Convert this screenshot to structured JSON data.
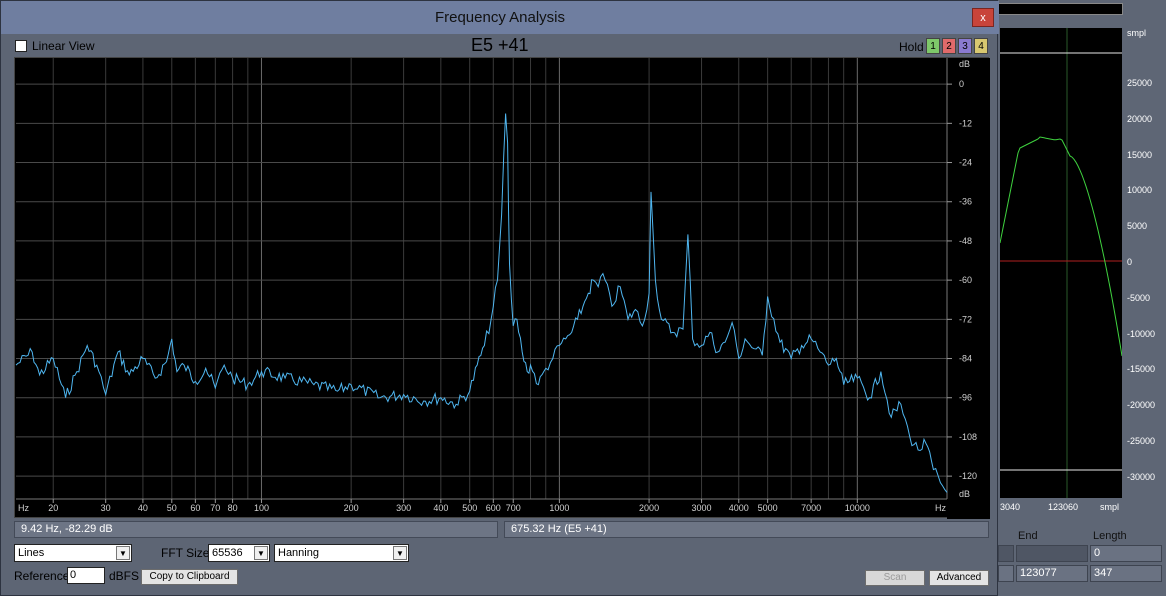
{
  "window": {
    "title": "Frequency Analysis",
    "close_label": "x"
  },
  "toolbar": {
    "linear_view_label": "Linear View",
    "linear_view_checked": false,
    "note_display": "E5 +41",
    "hold_label": "Hold",
    "hold_buttons": [
      {
        "label": "1",
        "color": "#7ec86a"
      },
      {
        "label": "2",
        "color": "#e06a6a"
      },
      {
        "label": "3",
        "color": "#8a7ad0"
      },
      {
        "label": "4",
        "color": "#d8c870"
      }
    ]
  },
  "chart_data": {
    "type": "line",
    "x_scale": "log",
    "xlim": [
      15,
      20000
    ],
    "ylim": [
      -127,
      8
    ],
    "y_unit_label": "dB",
    "x_unit_label": "Hz",
    "y_ticks": [
      "0",
      "-12",
      "-24",
      "-36",
      "-48",
      "-60",
      "-72",
      "-84",
      "-96",
      "-108",
      "-120"
    ],
    "x_ticks": [
      {
        "v": 20,
        "label": "20"
      },
      {
        "v": 30,
        "label": "30"
      },
      {
        "v": 40,
        "label": "40"
      },
      {
        "v": 50,
        "label": "50"
      },
      {
        "v": 60,
        "label": "60"
      },
      {
        "v": 70,
        "label": "70"
      },
      {
        "v": 80,
        "label": "80"
      },
      {
        "v": 100,
        "label": "100"
      },
      {
        "v": 200,
        "label": "200"
      },
      {
        "v": 300,
        "label": "300"
      },
      {
        "v": 400,
        "label": "400"
      },
      {
        "v": 500,
        "label": "500"
      },
      {
        "v": 600,
        "label": "600"
      },
      {
        "v": 700,
        "label": "700"
      },
      {
        "v": 1000,
        "label": "1000"
      },
      {
        "v": 2000,
        "label": "2000"
      },
      {
        "v": 3000,
        "label": "3000"
      },
      {
        "v": 4000,
        "label": "4000"
      },
      {
        "v": 5000,
        "label": "5000"
      },
      {
        "v": 7000,
        "label": "7000"
      },
      {
        "v": 10000,
        "label": "10000"
      }
    ],
    "series_color": "#4fb6f0",
    "series": [
      {
        "x": [
          15,
          17,
          18,
          20,
          22,
          24,
          26,
          28,
          30,
          33,
          36,
          40,
          44,
          48,
          50,
          52,
          55,
          60,
          65,
          70,
          75,
          80,
          90,
          100,
          120,
          150,
          180,
          200,
          250,
          300,
          350,
          400,
          450,
          500,
          530,
          560,
          590,
          620,
          640,
          650,
          660,
          670,
          675,
          680,
          690,
          700,
          720,
          750,
          780,
          800,
          850,
          900,
          950,
          1000,
          1050,
          1100,
          1150,
          1200,
          1250,
          1300,
          1350,
          1400,
          1500,
          1600,
          1700,
          1800,
          1900,
          2000,
          2030,
          2100,
          2200,
          2400,
          2600,
          2700,
          2800,
          3000,
          3200,
          3400,
          3600,
          3800,
          4000,
          4200,
          4500,
          4800,
          5000,
          5500,
          6000,
          6500,
          7000,
          7500,
          8000,
          8500,
          9000,
          10000,
          11000,
          12000,
          13000,
          14000,
          15000,
          16000,
          17000,
          18000,
          19000,
          20000
        ],
        "y": [
          -86,
          -82,
          -89,
          -84,
          -96,
          -88,
          -80,
          -86,
          -95,
          -82,
          -89,
          -84,
          -90,
          -85,
          -78,
          -88,
          -86,
          -91,
          -87,
          -93,
          -86,
          -90,
          -92,
          -88,
          -90,
          -92,
          -94,
          -92,
          -96,
          -95,
          -97,
          -96,
          -98,
          -94,
          -86,
          -80,
          -72,
          -60,
          -40,
          -22,
          -9,
          -18,
          -38,
          -55,
          -66,
          -74,
          -72,
          -82,
          -88,
          -86,
          -92,
          -87,
          -84,
          -80,
          -78,
          -76,
          -72,
          -68,
          -64,
          -60,
          -62,
          -58,
          -68,
          -62,
          -72,
          -69,
          -74,
          -64,
          -33,
          -60,
          -72,
          -76,
          -75,
          -46,
          -78,
          -80,
          -76,
          -82,
          -79,
          -73,
          -84,
          -78,
          -81,
          -83,
          -65,
          -79,
          -84,
          -80,
          -78,
          -82,
          -86,
          -84,
          -92,
          -90,
          -96,
          -88,
          -102,
          -98,
          -108,
          -112,
          -110,
          -118,
          -122,
          -125
        ]
      }
    ]
  },
  "status": {
    "cursor_readout": "9.42 Hz, -82.29 dB",
    "peak_readout": "675.32 Hz (E5 +41)"
  },
  "controls": {
    "display_mode": "Lines",
    "fft_size_label": "FFT Size",
    "fft_size": "65536",
    "window_function": "Hanning",
    "reference_label": "Reference",
    "reference_value": "0",
    "reference_unit": "dBFS",
    "copy_button": "Copy to Clipboard",
    "scan_button": "Scan",
    "advanced_button": "Advanced"
  },
  "background_editor": {
    "ruler_unit": "smpl",
    "ruler_labels": [
      "25000",
      "20000",
      "15000",
      "10000",
      "5000",
      "0",
      "-5000",
      "-10000",
      "-15000",
      "-20000",
      "-25000",
      "-30000"
    ],
    "x_labels": [
      "3040",
      "123060",
      "smpl"
    ],
    "wave_color": "#3fd23f",
    "headers": [
      "End",
      "Length"
    ],
    "row1": [
      "",
      "",
      "0"
    ],
    "row2": [
      "",
      "123077",
      "347"
    ]
  }
}
